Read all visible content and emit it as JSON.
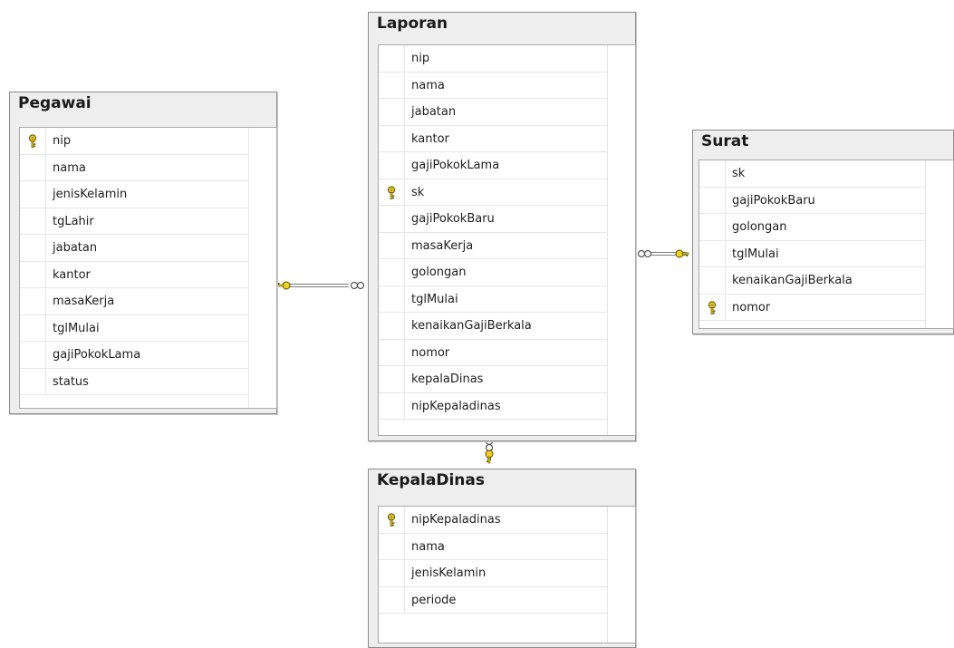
{
  "tables": [
    {
      "id": "pegawai",
      "title": "Pegawai",
      "columns": [
        {
          "name": "nip",
          "pk": true
        },
        {
          "name": "nama",
          "pk": false
        },
        {
          "name": "jenisKelamin",
          "pk": false
        },
        {
          "name": "tgLahir",
          "pk": false
        },
        {
          "name": "jabatan",
          "pk": false
        },
        {
          "name": "kantor",
          "pk": false
        },
        {
          "name": "masaKerja",
          "pk": false
        },
        {
          "name": "tglMulai",
          "pk": false
        },
        {
          "name": "gajiPokokLama",
          "pk": false
        },
        {
          "name": "status",
          "pk": false
        }
      ]
    },
    {
      "id": "laporan",
      "title": "Laporan",
      "columns": [
        {
          "name": "nip",
          "pk": false
        },
        {
          "name": "nama",
          "pk": false
        },
        {
          "name": "jabatan",
          "pk": false
        },
        {
          "name": "kantor",
          "pk": false
        },
        {
          "name": "gajiPokokLama",
          "pk": false
        },
        {
          "name": "sk",
          "pk": true
        },
        {
          "name": "gajiPokokBaru",
          "pk": false
        },
        {
          "name": "masaKerja",
          "pk": false
        },
        {
          "name": "golongan",
          "pk": false
        },
        {
          "name": "tglMulai",
          "pk": false
        },
        {
          "name": "kenaikanGajiBerkala",
          "pk": false
        },
        {
          "name": "nomor",
          "pk": false
        },
        {
          "name": "kepalaDinas",
          "pk": false
        },
        {
          "name": "nipKepaladinas",
          "pk": false
        }
      ]
    },
    {
      "id": "surat",
      "title": "Surat",
      "columns": [
        {
          "name": "sk",
          "pk": false
        },
        {
          "name": "gajiPokokBaru",
          "pk": false
        },
        {
          "name": "golongan",
          "pk": false
        },
        {
          "name": "tglMulai",
          "pk": false
        },
        {
          "name": "kenaikanGajiBerkala",
          "pk": false
        },
        {
          "name": "nomor",
          "pk": true
        }
      ]
    },
    {
      "id": "kepaladinas",
      "title": "KepalaDinas",
      "columns": [
        {
          "name": "nipKepaladinas",
          "pk": true
        },
        {
          "name": "nama",
          "pk": false
        },
        {
          "name": "jenisKelamin",
          "pk": false
        },
        {
          "name": "periode",
          "pk": false
        }
      ]
    }
  ],
  "relationships": [
    {
      "id": "pegawai-laporan",
      "one": "pegawai",
      "many": "laporan"
    },
    {
      "id": "surat-laporan",
      "one": "surat",
      "many": "laporan"
    },
    {
      "id": "kepaladinas-laporan",
      "one": "kepaladinas",
      "many": "laporan"
    }
  ],
  "colors": {
    "key_fill": "#f2d21c",
    "key_stroke": "#5a4a00",
    "line": "#7a7a7a"
  },
  "icons": {
    "primary_key": "key-icon",
    "one_end": "key-icon",
    "many_end": "infinity-icon"
  }
}
